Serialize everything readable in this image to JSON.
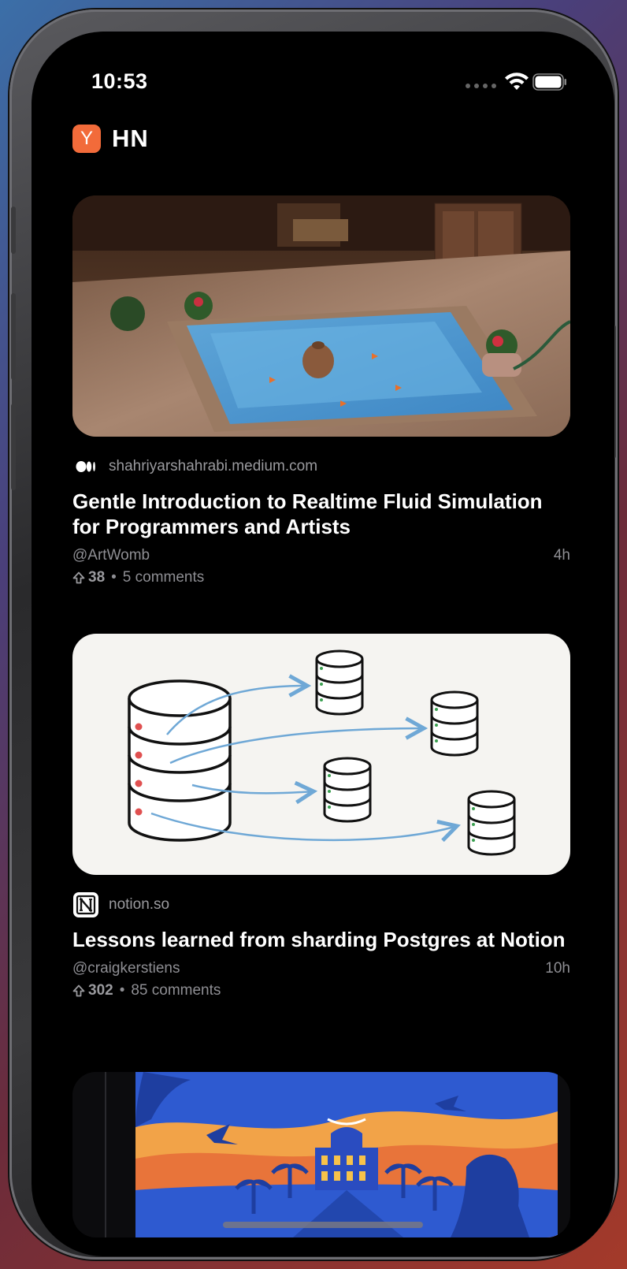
{
  "status_bar": {
    "time": "10:53"
  },
  "header": {
    "logo_letter": "Y",
    "title": "HN"
  },
  "stories": [
    {
      "source": "shahriyarshahrabi.medium.com",
      "source_icon": "medium-icon",
      "title": "Gentle Introduction to Realtime Fluid Simulation for Programmers and Artists",
      "author": "@ArtWomb",
      "age": "4h",
      "points": "38",
      "comments": "5 comments",
      "thumbnail": "courtyard-pool-image"
    },
    {
      "source": "notion.so",
      "source_icon": "notion-icon",
      "title": "Lessons learned from sharding Postgres at Notion",
      "author": "@craigkerstiens",
      "age": "10h",
      "points": "302",
      "comments": "85 comments",
      "thumbnail": "database-sharding-diagram"
    },
    {
      "thumbnail": "desert-palace-illustration"
    }
  ],
  "colors": {
    "accent": "#f26b3a",
    "background": "#000000",
    "diagram_arrow": "#6fa8d6",
    "diagram_dot": "#e05050"
  }
}
